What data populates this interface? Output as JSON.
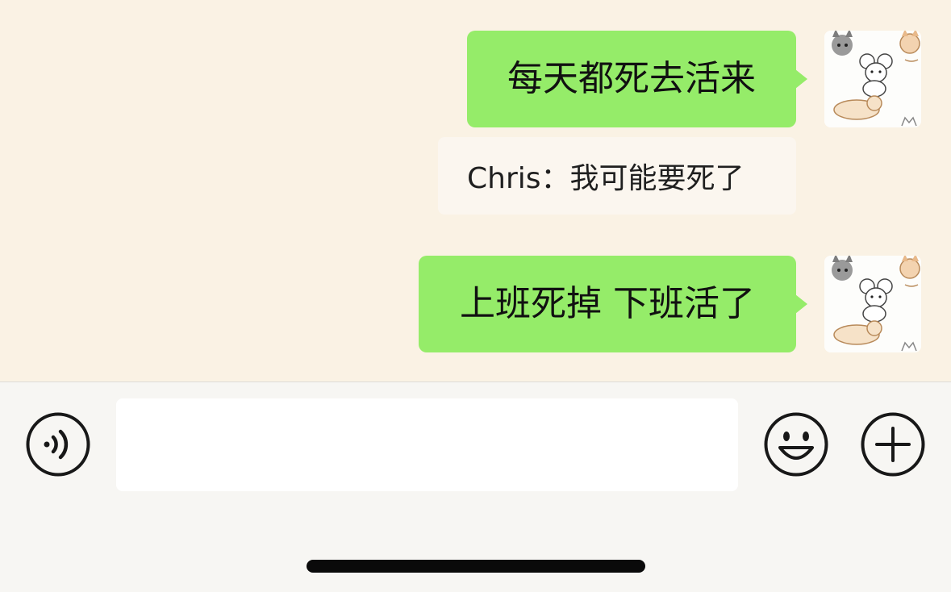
{
  "messages": [
    {
      "text": "每天都死去活来",
      "sender": "self",
      "avatar": "cats-sticker-avatar"
    },
    {
      "text": "上班死掉 下班活了",
      "sender": "self",
      "avatar": "cats-sticker-avatar"
    }
  ],
  "quote": {
    "text": "Chris：我可能要死了"
  },
  "input_bar": {
    "voice_icon": "voice-icon",
    "emoji_icon": "emoji-icon",
    "plus_icon": "plus-icon",
    "input_value": ""
  },
  "colors": {
    "chat_background": "#faf2e4",
    "self_bubble": "#95ec69",
    "quote_background": "#fbf6ef",
    "input_bar_background": "#f7f6f3"
  }
}
